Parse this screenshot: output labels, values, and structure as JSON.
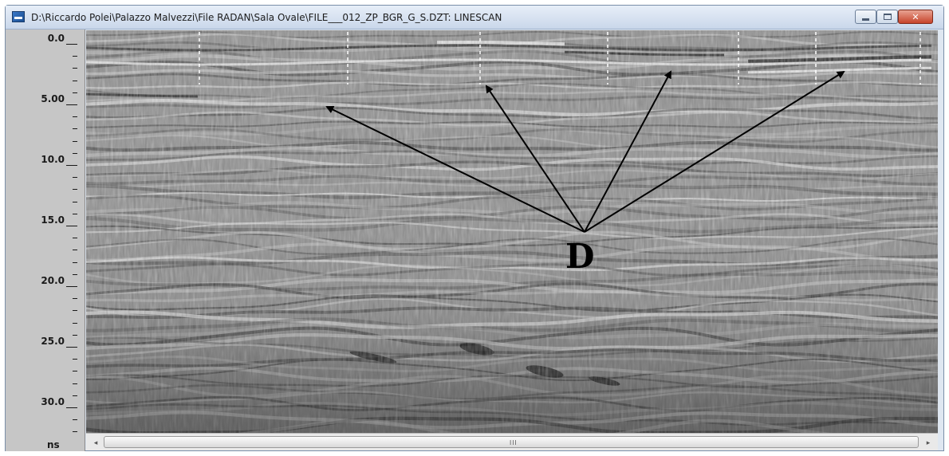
{
  "window": {
    "title": "D:\\Riccardo Polei\\Palazzo Malvezzi\\File RADAN\\Sala Ovale\\FILE___012_ZP_BGR_G_S.DZT:  LINESCAN",
    "icon": "radan-app-icon",
    "close_glyph": "✕"
  },
  "ruler": {
    "ticks": [
      "0.0",
      "5.00",
      "10.0",
      "15.0",
      "20.0",
      "25.0",
      "30.0"
    ],
    "unit": "ns",
    "range": [
      0,
      33
    ]
  },
  "annotation": {
    "label": "D"
  },
  "scrollbar": {
    "left_arrow": "◂",
    "right_arrow": "▸",
    "grip": "III"
  }
}
